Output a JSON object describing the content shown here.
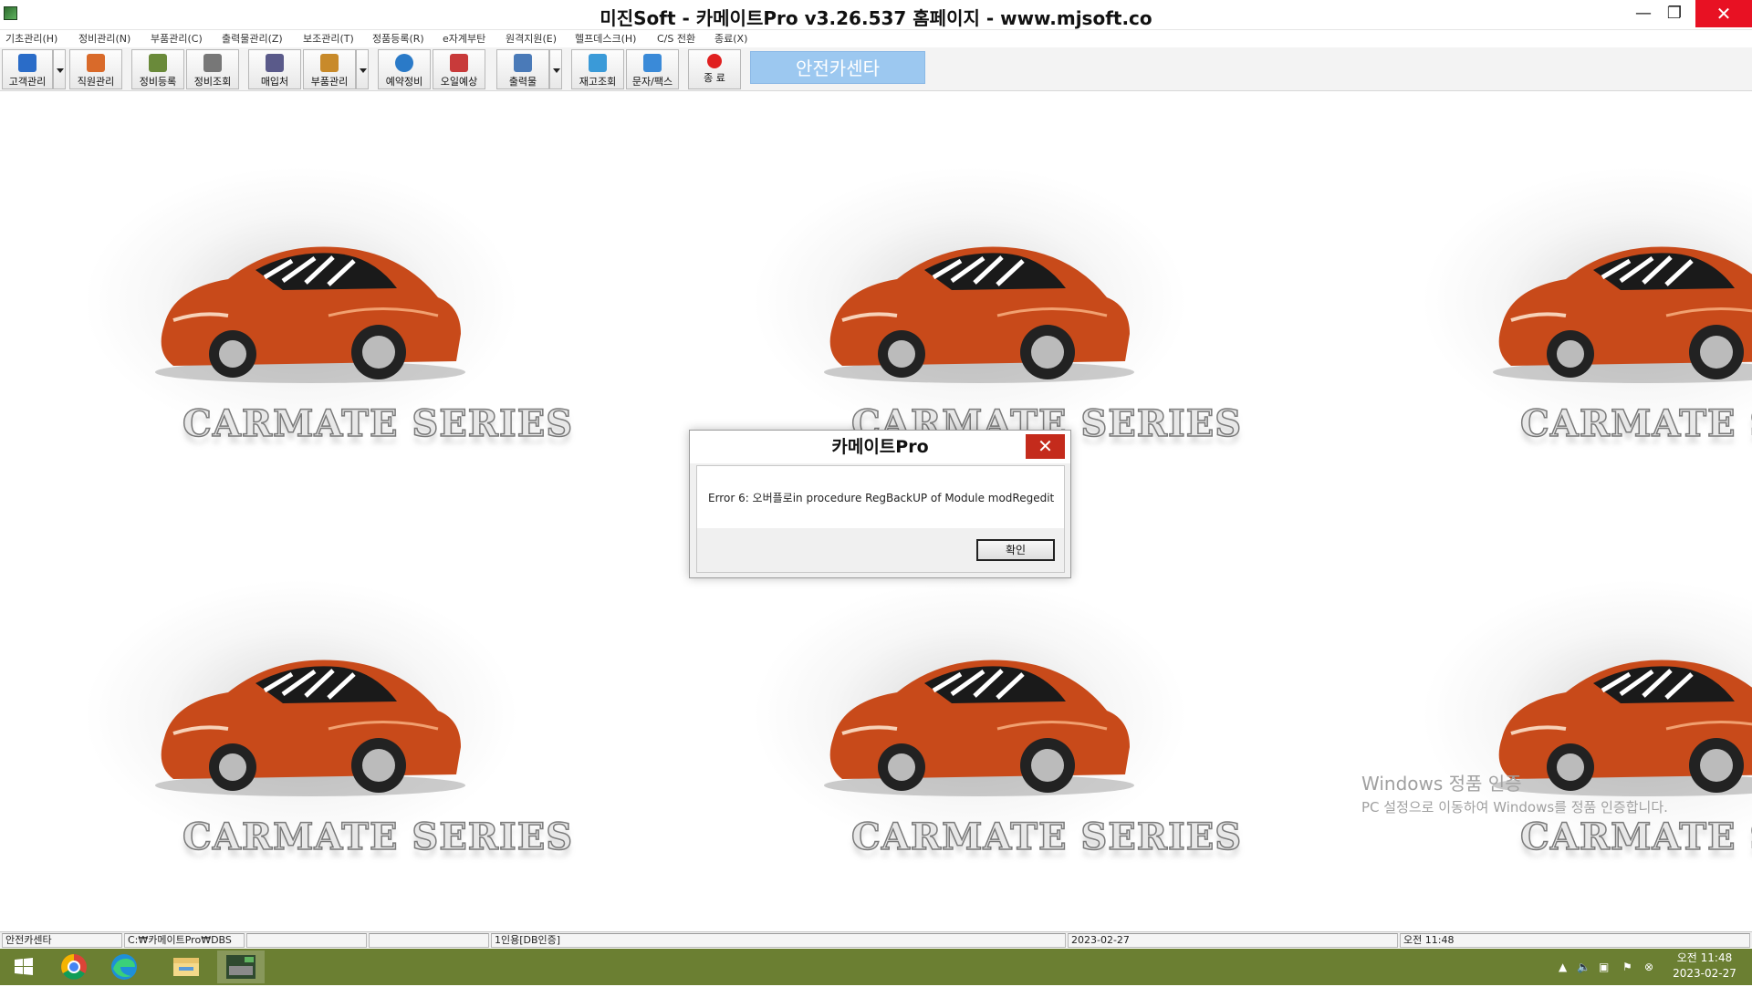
{
  "window": {
    "title": "미진Soft - 카메이트Pro v3.26.537 홈페이지 - www.mjsoft.co",
    "min_glyph": "—",
    "max_glyph": "❐",
    "close_glyph": "✕"
  },
  "menu": [
    "기초관리(H)",
    "정비관리(N)",
    "부품관리(C)",
    "출력물관리(Z)",
    "보조관리(T)",
    "정품등록(R)",
    "e자계부탄",
    "원격지원(E)",
    "헬프데스크(H)",
    "C/S 전환",
    "종료(X)"
  ],
  "toolbar": {
    "buttons": [
      {
        "label": "고객관리",
        "icon": "customer-icon",
        "color": "#2a6cc8"
      },
      {
        "label": "직원관리",
        "icon": "staff-icon",
        "color": "#d96a2a"
      },
      {
        "label": "정비등록",
        "icon": "repair-register-icon",
        "color": "#6a8a3a"
      },
      {
        "label": "정비조회",
        "icon": "repair-search-icon",
        "color": "#777777"
      },
      {
        "label": "매입처",
        "icon": "supplier-icon",
        "color": "#5a5a8a"
      },
      {
        "label": "부품관리",
        "icon": "parts-icon",
        "color": "#c88a2a"
      },
      {
        "label": "예약정비",
        "icon": "reservation-icon",
        "color": "#2a7ac8"
      },
      {
        "label": "오일예상",
        "icon": "oil-icon",
        "color": "#c83a3a"
      },
      {
        "label": "출력물",
        "icon": "printer-icon",
        "color": "#4a7ab8"
      },
      {
        "label": "재고조회",
        "icon": "inventory-icon",
        "color": "#3a9ad8"
      },
      {
        "label": "문자/팩스",
        "icon": "message-icon",
        "color": "#3a8ad8"
      },
      {
        "label": "종 료",
        "icon": "exit-icon",
        "color": "#e02020"
      }
    ],
    "safety_center": "안전카센타"
  },
  "background": {
    "brand_text": "CARMATE SERIES",
    "watermark_line1": "Windows 정품 인증",
    "watermark_line2": "PC 설정으로 이동하여 Windows를 정품 인증합니다."
  },
  "dialog": {
    "title": "카메이트Pro",
    "close_glyph": "✕",
    "message": "Error 6: 오버플로in procedure RegBackUP of Module modRegedit",
    "ok_label": "확인"
  },
  "statusbar": {
    "shop": "안전카센타",
    "path": "C:₩카메이트Pro₩DBS",
    "blank1": "",
    "blank2": "",
    "license": "1인용[DB인증]",
    "date": "2023-02-27",
    "time": "오전 11:48"
  },
  "taskbar": {
    "clock_time": "오전 11:48",
    "clock_date": "2023-02-27",
    "pinned": [
      "windows-start-icon",
      "chrome-icon",
      "edge-icon",
      "file-explorer-icon",
      "carmate-pro-icon"
    ]
  },
  "colors": {
    "taskbar": "#6b7f32",
    "close_red": "#e81123",
    "safety_button": "#9cc8f0"
  }
}
